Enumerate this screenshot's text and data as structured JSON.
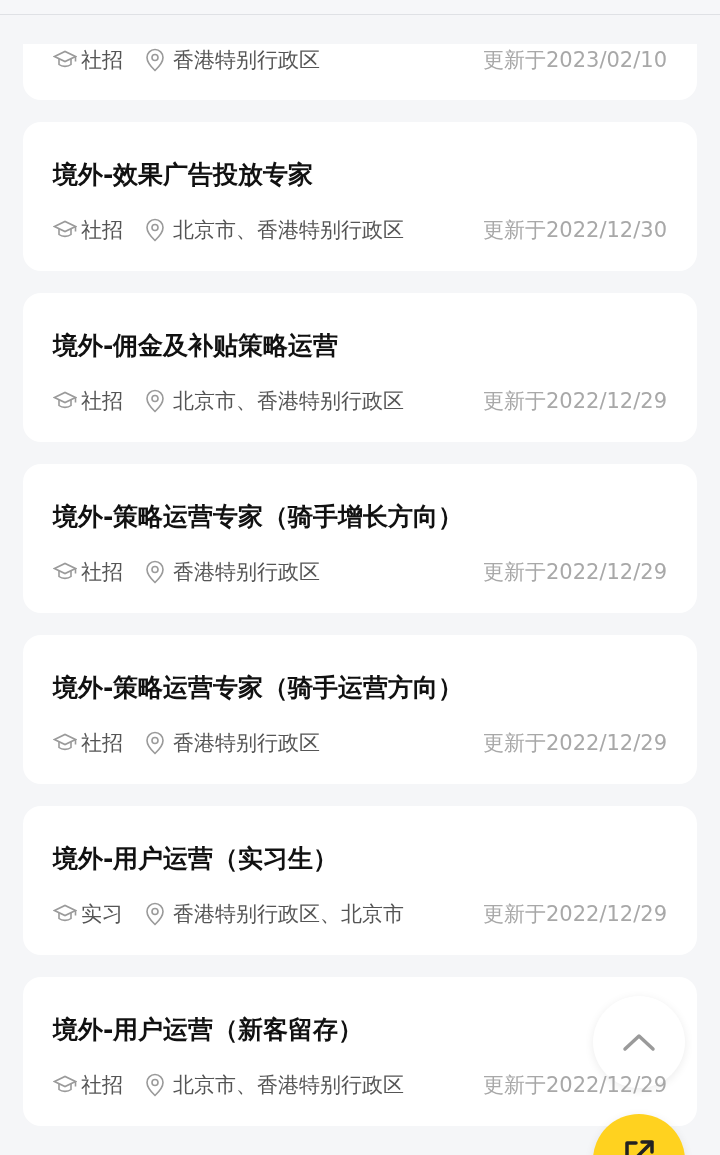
{
  "jobs": [
    {
      "type": "社招",
      "location": "香港特别行政区",
      "updated": "更新于2023/02/10"
    },
    {
      "title": "境外-效果广告投放专家",
      "type": "社招",
      "location": "北京市、香港特别行政区",
      "updated": "更新于2022/12/30"
    },
    {
      "title": "境外-佣金及补贴策略运营",
      "type": "社招",
      "location": "北京市、香港特别行政区",
      "updated": "更新于2022/12/29"
    },
    {
      "title": "境外-策略运营专家（骑手增长方向）",
      "type": "社招",
      "location": "香港特别行政区",
      "updated": "更新于2022/12/29"
    },
    {
      "title": "境外-策略运营专家（骑手运营方向）",
      "type": "社招",
      "location": "香港特别行政区",
      "updated": "更新于2022/12/29"
    },
    {
      "title": "境外-用户运营（实习生）",
      "type": "实习",
      "location": "香港特别行政区、北京市",
      "updated": "更新于2022/12/29"
    },
    {
      "title": "境外-用户运营（新客留存）",
      "type": "社招",
      "location": "北京市、香港特别行政区",
      "updated": "更新于2022/12/29"
    }
  ]
}
